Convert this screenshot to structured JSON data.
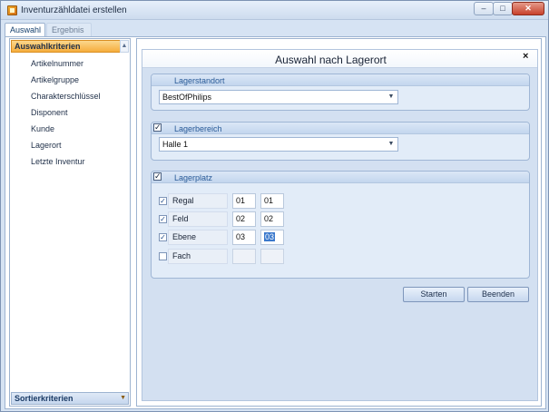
{
  "window": {
    "title": "Inventurzähldatei erstellen",
    "minimize": "–",
    "maximize": "□",
    "close": "✕"
  },
  "tabs": [
    {
      "label": "Auswahl"
    },
    {
      "label": "Ergebnis"
    }
  ],
  "sidebar": {
    "header": "Auswahlkriterien",
    "items": [
      {
        "label": "Artikelnummer"
      },
      {
        "label": "Artikelgruppe"
      },
      {
        "label": "Charakterschlüssel"
      },
      {
        "label": "Disponent"
      },
      {
        "label": "Kunde"
      },
      {
        "label": "Lagerort"
      },
      {
        "label": "Letzte Inventur"
      }
    ],
    "footer": "Sortierkriterien"
  },
  "panel": {
    "title": "Auswahl nach Lagerort",
    "close": "×"
  },
  "lagerstandort": {
    "label": "Lagerstandort",
    "value": "BestOfPhilips"
  },
  "lagerbereich": {
    "label": "Lagerbereich",
    "checked": true,
    "value": "Halle 1"
  },
  "lagerplatz": {
    "label": "Lagerplatz",
    "checked": true,
    "rows": [
      {
        "label": "Regal",
        "checked": true,
        "from": "01",
        "to": "01"
      },
      {
        "label": "Feld",
        "checked": true,
        "from": "02",
        "to": "02"
      },
      {
        "label": "Ebene",
        "checked": true,
        "from": "03",
        "to": "03"
      },
      {
        "label": "Fach",
        "checked": false,
        "from": "",
        "to": ""
      }
    ]
  },
  "buttons": {
    "start": "Starten",
    "end": "Beenden"
  }
}
